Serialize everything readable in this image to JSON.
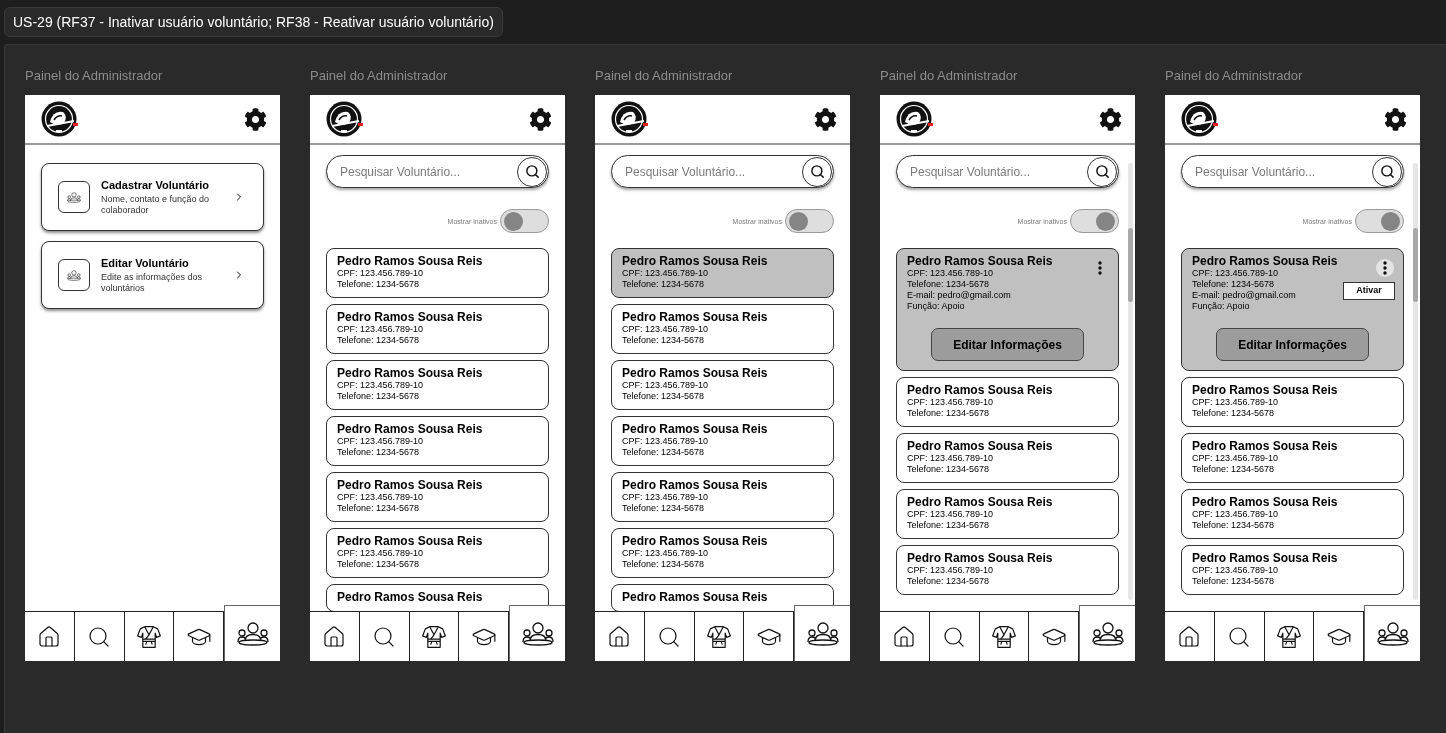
{
  "title": "US-29 (RF37 - Inativar usuário voluntário; RF38 - Reativar usuário voluntário)",
  "screens": [
    {
      "label": "Painel do Administrador",
      "kind": "menu",
      "menu_cards": [
        {
          "title": "Cadastrar Voluntário",
          "description": "Nome, contato e função do colaborador"
        },
        {
          "title": "Editar Voluntário",
          "description": "Edite as informações dos voluntários"
        }
      ],
      "nav": [
        {
          "kind": "home",
          "selected": false
        },
        {
          "kind": "search",
          "selected": false
        },
        {
          "kind": "kimono",
          "selected": false
        },
        {
          "kind": "graduation",
          "selected": false
        },
        {
          "kind": "people",
          "selected": true
        }
      ]
    },
    {
      "label": "Painel do Administrador",
      "kind": "list",
      "search": {
        "placeholder": "Pesquisar Voluntário..."
      },
      "toggle": {
        "label": "Mostrar inativos",
        "on": false
      },
      "volunteers": [
        {
          "name": "Pedro Ramos Sousa Reis",
          "cpf": "CPF: 123.456.789-10",
          "phone": "Telefone: 1234-5678",
          "selected": false,
          "expanded": false
        },
        {
          "name": "Pedro Ramos Sousa Reis",
          "cpf": "CPF: 123.456.789-10",
          "phone": "Telefone: 1234-5678",
          "selected": false,
          "expanded": false
        },
        {
          "name": "Pedro Ramos Sousa Reis",
          "cpf": "CPF: 123.456.789-10",
          "phone": "Telefone: 1234-5678",
          "selected": false,
          "expanded": false
        },
        {
          "name": "Pedro Ramos Sousa Reis",
          "cpf": "CPF: 123.456.789-10",
          "phone": "Telefone: 1234-5678",
          "selected": false,
          "expanded": false
        },
        {
          "name": "Pedro Ramos Sousa Reis",
          "cpf": "CPF: 123.456.789-10",
          "phone": "Telefone: 1234-5678",
          "selected": false,
          "expanded": false
        },
        {
          "name": "Pedro Ramos Sousa Reis",
          "cpf": "CPF: 123.456.789-10",
          "phone": "Telefone: 1234-5678",
          "selected": false,
          "expanded": false
        },
        {
          "name": "Pedro Ramos Sousa Reis",
          "selected": false,
          "expanded": false
        }
      ],
      "nav": [
        {
          "kind": "home",
          "selected": false
        },
        {
          "kind": "search",
          "selected": false
        },
        {
          "kind": "kimono",
          "selected": false
        },
        {
          "kind": "graduation",
          "selected": false
        },
        {
          "kind": "people",
          "selected": true
        }
      ]
    },
    {
      "label": "Painel do Administrador",
      "kind": "list",
      "search": {
        "placeholder": "Pesquisar Voluntário..."
      },
      "toggle": {
        "label": "Mostrar inativos",
        "on": false
      },
      "volunteers": [
        {
          "name": "Pedro Ramos Sousa Reis",
          "cpf": "CPF: 123.456.789-10",
          "phone": "Telefone: 1234-5678",
          "selected": true,
          "expanded": false
        },
        {
          "name": "Pedro Ramos Sousa Reis",
          "cpf": "CPF: 123.456.789-10",
          "phone": "Telefone: 1234-5678",
          "selected": false,
          "expanded": false
        },
        {
          "name": "Pedro Ramos Sousa Reis",
          "cpf": "CPF: 123.456.789-10",
          "phone": "Telefone: 1234-5678",
          "selected": false,
          "expanded": false
        },
        {
          "name": "Pedro Ramos Sousa Reis",
          "cpf": "CPF: 123.456.789-10",
          "phone": "Telefone: 1234-5678",
          "selected": false,
          "expanded": false
        },
        {
          "name": "Pedro Ramos Sousa Reis",
          "cpf": "CPF: 123.456.789-10",
          "phone": "Telefone: 1234-5678",
          "selected": false,
          "expanded": false
        },
        {
          "name": "Pedro Ramos Sousa Reis",
          "cpf": "CPF: 123.456.789-10",
          "phone": "Telefone: 1234-5678",
          "selected": false,
          "expanded": false
        },
        {
          "name": "Pedro Ramos Sousa Reis",
          "selected": false,
          "expanded": false
        }
      ],
      "nav": [
        {
          "kind": "home",
          "selected": false
        },
        {
          "kind": "search",
          "selected": false
        },
        {
          "kind": "kimono",
          "selected": false
        },
        {
          "kind": "graduation",
          "selected": false
        },
        {
          "kind": "people",
          "selected": true
        }
      ]
    },
    {
      "label": "Painel do Administrador",
      "kind": "list",
      "scrollbar": true,
      "search": {
        "placeholder": "Pesquisar Voluntário..."
      },
      "toggle": {
        "label": "Mostrar inativos",
        "on": true
      },
      "volunteers": [
        {
          "name": "Pedro Ramos Sousa Reis",
          "cpf": "CPF: 123.456.789-10",
          "phone": "Telefone: 1234-5678",
          "email": "E-mail: pedro@gmail.com",
          "role": "Função: Apoio",
          "edit_button": "Editar Informações",
          "selected": true,
          "expanded": true,
          "menu_open": false
        },
        {
          "name": "Pedro Ramos Sousa Reis",
          "cpf": "CPF: 123.456.789-10",
          "phone": "Telefone: 1234-5678",
          "selected": false,
          "expanded": false
        },
        {
          "name": "Pedro Ramos Sousa Reis",
          "cpf": "CPF: 123.456.789-10",
          "phone": "Telefone: 1234-5678",
          "selected": false,
          "expanded": false
        },
        {
          "name": "Pedro Ramos Sousa Reis",
          "cpf": "CPF: 123.456.789-10",
          "phone": "Telefone: 1234-5678",
          "selected": false,
          "expanded": false
        },
        {
          "name": "Pedro Ramos Sousa Reis",
          "cpf": "CPF: 123.456.789-10",
          "phone": "Telefone: 1234-5678",
          "selected": false,
          "expanded": false
        }
      ],
      "nav": [
        {
          "kind": "home",
          "selected": false
        },
        {
          "kind": "search",
          "selected": false
        },
        {
          "kind": "kimono",
          "selected": false
        },
        {
          "kind": "graduation",
          "selected": false
        },
        {
          "kind": "people",
          "selected": true
        }
      ]
    },
    {
      "label": "Painel do Administrador",
      "kind": "list",
      "scrollbar": true,
      "search": {
        "placeholder": "Pesquisar Voluntário..."
      },
      "toggle": {
        "label": "Mostrar inativos",
        "on": true
      },
      "volunteers": [
        {
          "name": "Pedro Ramos Sousa Reis",
          "cpf": "CPF: 123.456.789-10",
          "phone": "Telefone: 1234-5678",
          "email": "E-mail: pedro@gmail.com",
          "role": "Função: Apoio",
          "edit_button": "Editar Informações",
          "selected": true,
          "expanded": true,
          "menu_open": true,
          "menu_action": "Ativar"
        },
        {
          "name": "Pedro Ramos Sousa Reis",
          "cpf": "CPF: 123.456.789-10",
          "phone": "Telefone: 1234-5678",
          "selected": false,
          "expanded": false
        },
        {
          "name": "Pedro Ramos Sousa Reis",
          "cpf": "CPF: 123.456.789-10",
          "phone": "Telefone: 1234-5678",
          "selected": false,
          "expanded": false
        },
        {
          "name": "Pedro Ramos Sousa Reis",
          "cpf": "CPF: 123.456.789-10",
          "phone": "Telefone: 1234-5678",
          "selected": false,
          "expanded": false
        },
        {
          "name": "Pedro Ramos Sousa Reis",
          "cpf": "CPF: 123.456.789-10",
          "phone": "Telefone: 1234-5678",
          "selected": false,
          "expanded": false
        }
      ],
      "nav": [
        {
          "kind": "home",
          "selected": false
        },
        {
          "kind": "search",
          "selected": false
        },
        {
          "kind": "kimono",
          "selected": false
        },
        {
          "kind": "graduation",
          "selected": false
        },
        {
          "kind": "people",
          "selected": true
        }
      ]
    }
  ]
}
